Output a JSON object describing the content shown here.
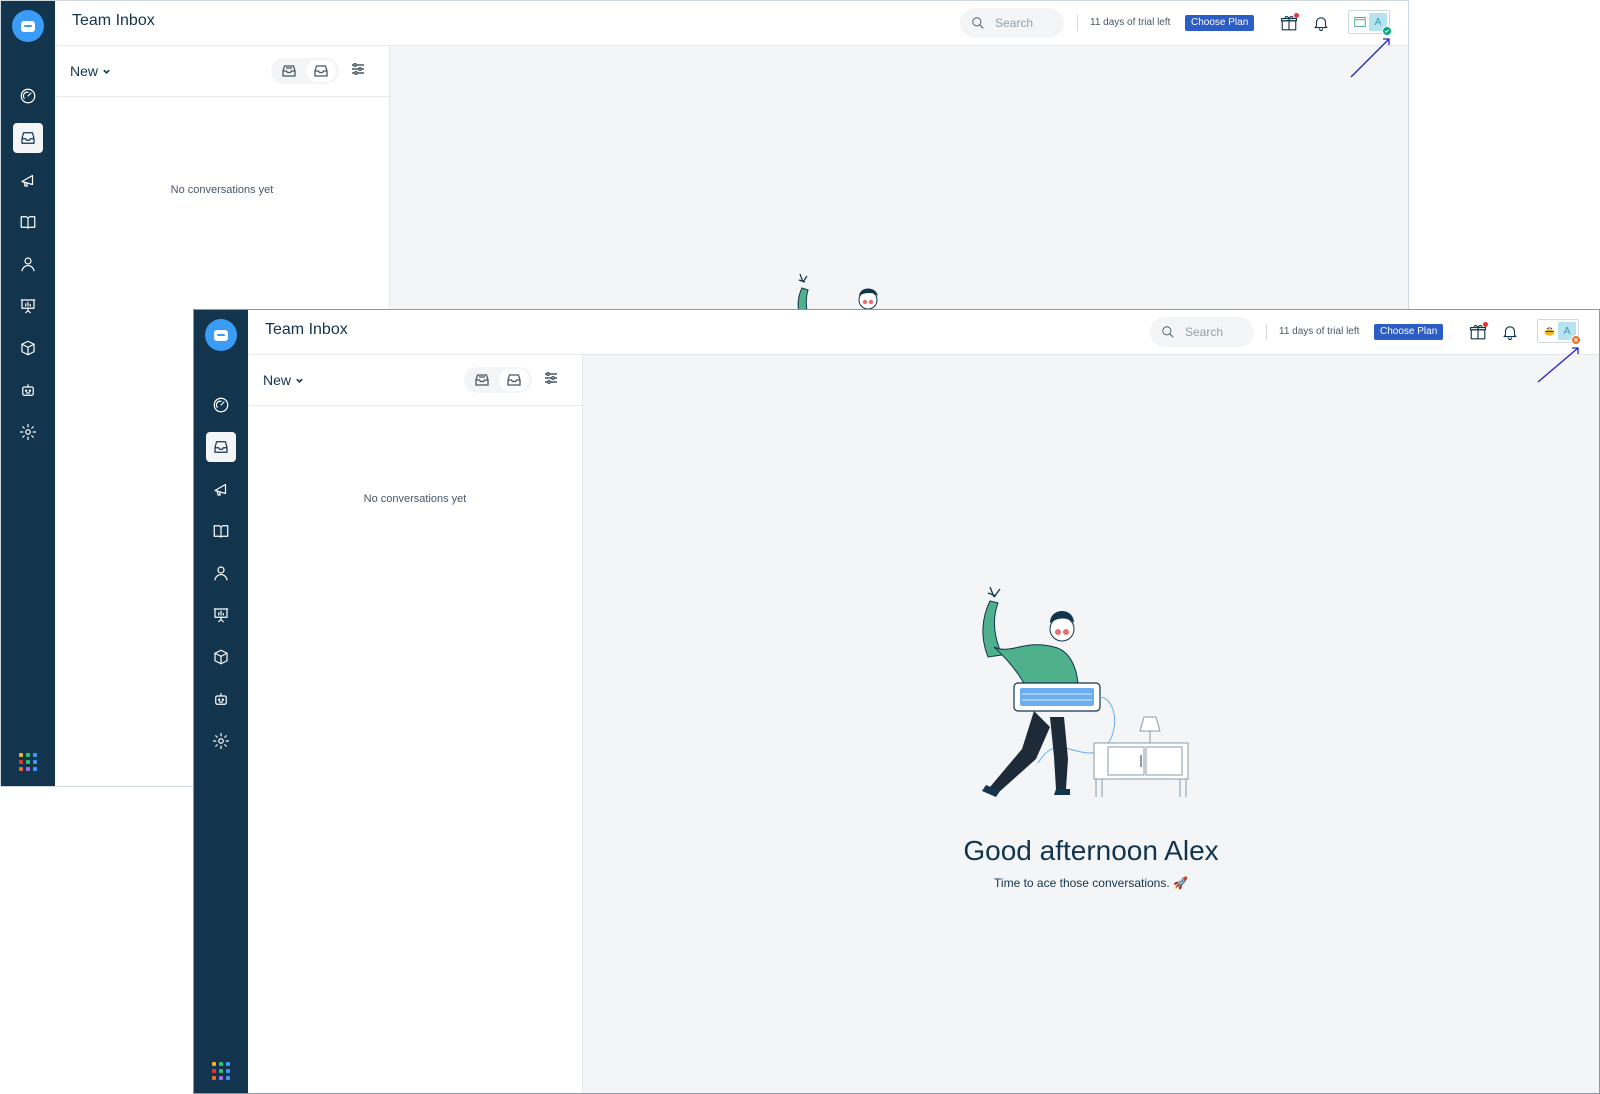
{
  "windows": {
    "back": {
      "header": {
        "title": "Team Inbox",
        "search_placeholder": "Search",
        "trial_text": "11 days of trial left",
        "choose_plan_label": "Choose Plan"
      },
      "list": {
        "filter_label": "New",
        "empty_text": "No conversations yet"
      },
      "avatar": {
        "initial": "A",
        "status": "online",
        "status_color": "#00a886"
      }
    },
    "front": {
      "header": {
        "title": "Team Inbox",
        "search_placeholder": "Search",
        "trial_text": "11 days of trial left",
        "choose_plan_label": "Choose Plan"
      },
      "list": {
        "filter_label": "New",
        "empty_text": "No conversations yet"
      },
      "avatar": {
        "initial": "A",
        "status": "busy",
        "status_color": "#e86f25"
      },
      "greeting": {
        "title": "Good afternoon Alex",
        "subtitle": "Time to ace those conversations. 🚀"
      }
    }
  },
  "sidebar": {
    "items": [
      {
        "name": "dashboard",
        "icon": "speedometer-icon"
      },
      {
        "name": "inbox",
        "icon": "inbox-icon",
        "active": true
      },
      {
        "name": "campaigns",
        "icon": "megaphone-icon"
      },
      {
        "name": "knowledge-base",
        "icon": "book-icon"
      },
      {
        "name": "contacts",
        "icon": "person-icon"
      },
      {
        "name": "analytics",
        "icon": "presentation-chart-icon"
      },
      {
        "name": "products",
        "icon": "cube-icon"
      },
      {
        "name": "bots",
        "icon": "bot-icon"
      },
      {
        "name": "settings",
        "icon": "gear-icon"
      }
    ],
    "apps_icon": "app-grid-icon"
  },
  "colors": {
    "sidebar": "#12344d",
    "accent": "#2c5cc5",
    "logo": "#3a9cf6",
    "annotation_arrow": "#2222cc",
    "illustration_shirt": "#4fb08c",
    "illustration_keyboard": "#6aaef0"
  }
}
